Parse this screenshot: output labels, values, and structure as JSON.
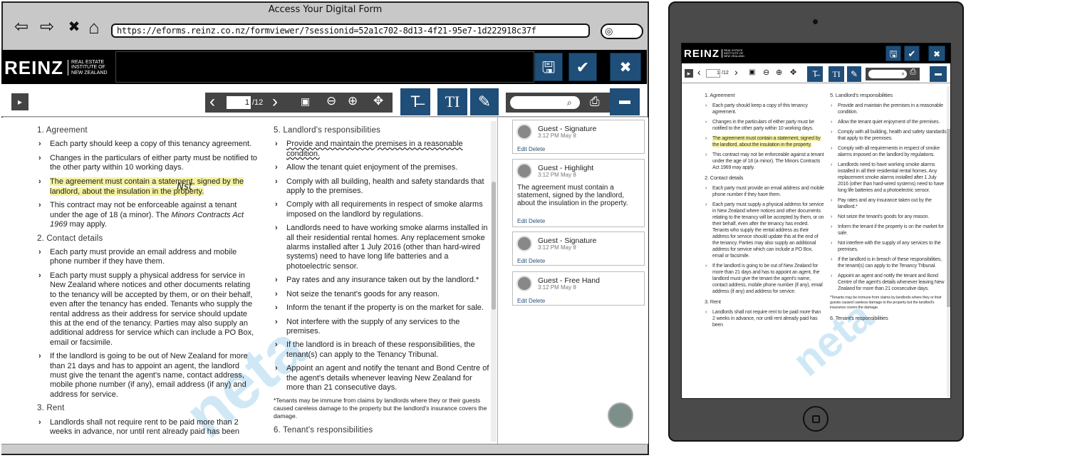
{
  "browser": {
    "title": "Access Your Digital Form",
    "url": "https://eforms.reinz.co.nz/formviewer/?sessionid=52a1c702-8d13-4f21-95e7-1d222918c37f",
    "nav": {
      "back": "⇦",
      "forward": "⇨",
      "stop": "✖",
      "home": "⌂"
    },
    "search_glyph": "◎"
  },
  "logo": {
    "mark": "REINZ",
    "line1": "REAL ESTATE",
    "line2": "INSTITUTE OF",
    "line3": "NEW ZEALAND"
  },
  "header_buttons": {
    "save": "🖫",
    "confirm": "✔",
    "close": "✖"
  },
  "toolbar": {
    "page_current": "1",
    "page_total": "/12",
    "prev": "‹",
    "next": "›",
    "fit": "▣",
    "zoom_out": "⊖",
    "zoom_in": "⊕",
    "pan": "✥",
    "text_tool": "T̶",
    "type_tool": "TI",
    "edit_tool": "✎",
    "search_glyph": "⌕",
    "print": "⎙",
    "comment": "▬",
    "panel": "▸"
  },
  "doc": {
    "col1": {
      "s1": "1. Agreement",
      "s1_items": [
        "Each party should keep a copy of this tenancy agreement.",
        "Changes in the particulars of either party must be notified to the other party within 10 working days."
      ],
      "s1_hl": "The agreement must contain a statement, signed by the landlord, about the insulation in the property.",
      "s1_hl_mark": "Nst",
      "s1_last_a": "This contract may not be enforceable against a tenant under the age of 18 (a minor). The ",
      "s1_last_em": "Minors Contracts Act 1969",
      "s1_last_b": " may apply.",
      "s2": "2. Contact details",
      "s2_items": [
        "Each party must provide an email address and mobile phone number if they have them.",
        "Each party must supply a physical address for service in New Zealand where notices and other documents relating to the tenancy will be accepted by them, or on their behalf, even after the tenancy has ended. Tenants who supply the rental address as their address for service should update this at the end of the tenancy. Parties may also supply an additional address for service which can include a PO Box, email or facsimile.",
        "If the landlord is going to be out of New Zealand for more than 21 days and has to appoint an agent, the landlord must give the tenant the agent's name, contact address, mobile phone number (if any), email address (if any) and address for service."
      ],
      "s3": "3. Rent",
      "s3_items": [
        "Landlords shall not require rent to be paid more than 2 weeks in advance, nor until rent already paid has been"
      ]
    },
    "col2": {
      "s5": "5. Landlord's responsibilities",
      "s5_first": "Provide and maintain the premises in a reasonable condition.",
      "s5_items": [
        "Allow the tenant quiet enjoyment of the premises.",
        "Comply with all building, health and safety standards that apply to the premises.",
        "Comply with all requirements in respect of smoke alarms imposed on the landlord by regulations.",
        "Landlords need to have working smoke alarms installed in all their residential rental homes. Any replacement smoke alarms installed after 1 July 2016 (other than hard-wired systems) need to have long life batteries and a photoelectric sensor.",
        "Pay rates and any insurance taken out by the landlord.*",
        "Not seize the tenant's goods for any reason.",
        "Inform the tenant if the property is on the market for sale.",
        "Not interfere with the supply of any services to the premises.",
        "If the landlord is in breach of these responsibilities, the tenant(s) can apply to the Tenancy Tribunal.",
        "Appoint an agent and notify the tenant and Bond Centre of the agent's details whenever leaving New Zealand for more than 21 consecutive days."
      ],
      "note": "*Tenants may be immune from claims by landlords where they or their guests caused careless damage to the property but the landlord's insurance covers the damage.",
      "s6": "6. Tenant's responsibilities"
    },
    "watermark": "neta"
  },
  "comments": [
    {
      "who": "Guest - Signature",
      "when": "3:12 PM May 8",
      "body": "",
      "edit": "Edit",
      "delete": "Delete"
    },
    {
      "who": "Guest - Highlight",
      "when": "3:12 PM May 8",
      "body": "The agreement must contain a statement, signed by the landlord, about the insulation in the property.",
      "edit": "Edit",
      "delete": "Delete"
    },
    {
      "who": "Guest - Signature",
      "when": "3:12 PM May 8",
      "body": "",
      "edit": "Edit",
      "delete": "Delete"
    },
    {
      "who": "Guest - Free Hand",
      "when": "3:12 PM May 8",
      "body": "",
      "edit": "Edit",
      "delete": "Delete"
    }
  ],
  "tablet": {
    "page_current": "1",
    "page_total": "/12",
    "col1": {
      "s1": "1. Agreement",
      "items": [
        "Each party should keep a copy of this tenancy agreement.",
        "Changes in the particulars of either party must be notified to the other party within 10 working days.",
        "This contract may not be enforceable against a tenant under the age of 18 (a minor). The Minors Contracts Act 1969 may apply."
      ],
      "hl": "The agreement must contain a statement, signed by the landlord, about the insulation in the property.",
      "s2": "2. Contact details",
      "s2_items": [
        "Each party must provide an email address and mobile phone number if they have them.",
        "Each party must supply a physical address for service in New Zealand where notices and other documents relating to the tenancy will be accepted by them, or on their behalf, even after the tenancy has ended. Tenants who supply the rental address as their address for service should update this at the end of the tenancy. Parties may also supply an additional address for service which can include a PO Box, email or facsimile.",
        "If the landlord is going to be out of New Zealand for more than 21 days and has to appoint an agent, the landlord must give the tenant the agent's name, contact address, mobile phone number (if any), email address (if any) and address for service."
      ],
      "s3": "3. Rent",
      "s3_items": [
        "Landlords shall not require rent to be paid more than 2 weeks in advance, nor until rent already paid has been"
      ]
    },
    "col2": {
      "s5": "5. Landlord's responsibilities",
      "items": [
        "Provide and maintain the premises in a reasonable condition.",
        "Allow the tenant quiet enjoyment of the premises.",
        "Comply with all building, health and safety standards that apply to the premises.",
        "Comply with all requirements in respect of smoke alarms imposed on the landlord by regulations.",
        "Landlords need to have working smoke alarms installed in all their residential rental homes. Any replacement smoke alarms installed after 1 July 2016 (other than hard-wired systems) need to have long life batteries and a photoelectric sensor.",
        "Pay rates and any insurance taken out by the landlord.*",
        "Not seize the tenant's goods for any reason.",
        "Inform the tenant if the property is on the market for sale.",
        "Not interfere with the supply of any services to the premises.",
        "If the landlord is in breach of these responsibilities, the tenant(s) can apply to the Tenancy Tribunal.",
        "Appoint an agent and notify the tenant and Bond Centre of the agent's details whenever leaving New Zealand for more than 21 consecutive days."
      ],
      "note": "*Tenants may be immune from claims by landlords where they or their guests caused careless damage to the property but the landlord's insurance covers the damage.",
      "s6": "6. Tenant's responsibilities"
    }
  }
}
